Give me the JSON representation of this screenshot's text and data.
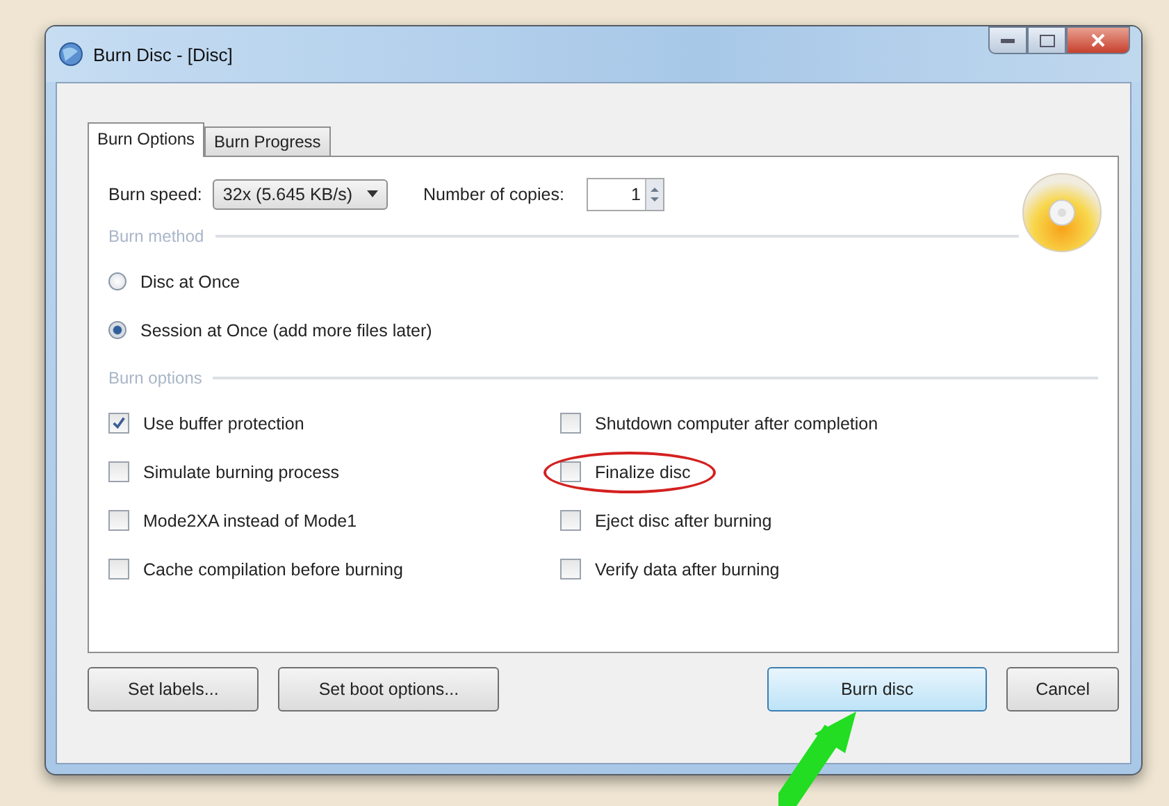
{
  "window": {
    "title": "Burn Disc - [Disc]"
  },
  "tabs": [
    {
      "label": "Burn Options",
      "selected": true
    },
    {
      "label": "Burn Progress",
      "selected": false
    }
  ],
  "burn_speed": {
    "label": "Burn speed:",
    "value": "32x (5.645 KB/s)"
  },
  "copies": {
    "label": "Number of copies:",
    "value": "1"
  },
  "burn_method": {
    "heading": "Burn method",
    "options": [
      {
        "label": "Disc at Once",
        "selected": false
      },
      {
        "label": "Session at Once (add more files later)",
        "selected": true
      }
    ]
  },
  "burn_options": {
    "heading": "Burn options",
    "checkboxes": [
      {
        "label": "Use buffer protection",
        "checked": true,
        "annotated": false
      },
      {
        "label": "Shutdown computer after completion",
        "checked": false,
        "annotated": false
      },
      {
        "label": "Simulate burning process",
        "checked": false,
        "annotated": false
      },
      {
        "label": "Finalize disc",
        "checked": false,
        "annotated": true
      },
      {
        "label": "Mode2XA instead of Mode1",
        "checked": false,
        "annotated": false
      },
      {
        "label": "Eject disc after burning",
        "checked": false,
        "annotated": false
      },
      {
        "label": "Cache compilation before burning",
        "checked": false,
        "annotated": false
      },
      {
        "label": "Verify data after burning",
        "checked": false,
        "annotated": false
      }
    ]
  },
  "buttons": [
    {
      "label": "Set labels...",
      "kind": "left",
      "annotated": false
    },
    {
      "label": "Set boot options...",
      "kind": "left",
      "annotated": false
    },
    {
      "label": "Burn disc",
      "kind": "right",
      "annotated": true
    },
    {
      "label": "Cancel",
      "kind": "right",
      "annotated": false
    }
  ]
}
